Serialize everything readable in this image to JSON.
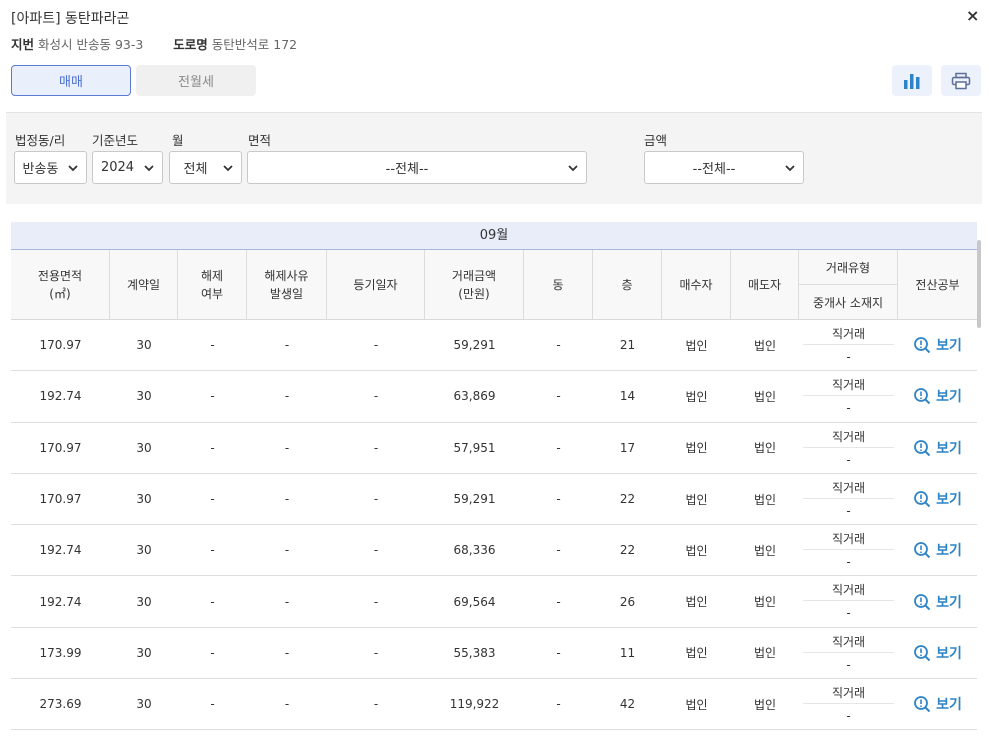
{
  "header": {
    "title": "[아파트] 동탄파라곤",
    "jibun_label": "지번",
    "jibun_value": "화성시 반송동 93-3",
    "road_label": "도로명",
    "road_value": "동탄반석로 172",
    "close_glyph": "×"
  },
  "tabs": {
    "active": "매매",
    "inactive": "전월세"
  },
  "icons": {
    "chart": "bar-chart-icon",
    "print": "print-icon"
  },
  "filters": {
    "dong_label": "법정동/리",
    "dong_value": "반송동",
    "year_label": "기준년도",
    "year_value": "2024",
    "month_label": "월",
    "month_value": "전체",
    "area_label": "면적",
    "area_value": "--전체--",
    "amount_label": "금액",
    "amount_value": "--전체--"
  },
  "table": {
    "month_header": "09월",
    "columns": {
      "area": "전용면적\n(㎡)",
      "contract_day": "계약일",
      "cancel": "해제\n여부",
      "cancel_date": "해제사유\n발생일",
      "reg_date": "등기일자",
      "price": "거래금액\n(만원)",
      "dong": "동",
      "floor": "층",
      "buyer": "매수자",
      "seller": "매도자",
      "trade_type": "거래유형",
      "broker": "중개사 소재지",
      "doc": "전산공부"
    },
    "view_label": "보기",
    "rows": [
      {
        "area": "170.97",
        "day": "30",
        "cancel": "-",
        "cancel_date": "-",
        "reg": "-",
        "price": "59,291",
        "dong": "-",
        "floor": "21",
        "buyer": "법인",
        "seller": "법인",
        "type": "직거래",
        "broker": "-"
      },
      {
        "area": "192.74",
        "day": "30",
        "cancel": "-",
        "cancel_date": "-",
        "reg": "-",
        "price": "63,869",
        "dong": "-",
        "floor": "14",
        "buyer": "법인",
        "seller": "법인",
        "type": "직거래",
        "broker": "-"
      },
      {
        "area": "170.97",
        "day": "30",
        "cancel": "-",
        "cancel_date": "-",
        "reg": "-",
        "price": "57,951",
        "dong": "-",
        "floor": "17",
        "buyer": "법인",
        "seller": "법인",
        "type": "직거래",
        "broker": "-"
      },
      {
        "area": "170.97",
        "day": "30",
        "cancel": "-",
        "cancel_date": "-",
        "reg": "-",
        "price": "59,291",
        "dong": "-",
        "floor": "22",
        "buyer": "법인",
        "seller": "법인",
        "type": "직거래",
        "broker": "-"
      },
      {
        "area": "192.74",
        "day": "30",
        "cancel": "-",
        "cancel_date": "-",
        "reg": "-",
        "price": "68,336",
        "dong": "-",
        "floor": "22",
        "buyer": "법인",
        "seller": "법인",
        "type": "직거래",
        "broker": "-"
      },
      {
        "area": "192.74",
        "day": "30",
        "cancel": "-",
        "cancel_date": "-",
        "reg": "-",
        "price": "69,564",
        "dong": "-",
        "floor": "26",
        "buyer": "법인",
        "seller": "법인",
        "type": "직거래",
        "broker": "-"
      },
      {
        "area": "173.99",
        "day": "30",
        "cancel": "-",
        "cancel_date": "-",
        "reg": "-",
        "price": "55,383",
        "dong": "-",
        "floor": "11",
        "buyer": "법인",
        "seller": "법인",
        "type": "직거래",
        "broker": "-"
      },
      {
        "area": "273.69",
        "day": "30",
        "cancel": "-",
        "cancel_date": "-",
        "reg": "-",
        "price": "119,922",
        "dong": "-",
        "floor": "42",
        "buyer": "법인",
        "seller": "법인",
        "type": "직거래",
        "broker": "-"
      }
    ]
  },
  "colors": {
    "accent": "#4a6fd0",
    "link": "#2f84c7",
    "month_bg": "#e8edf9"
  }
}
